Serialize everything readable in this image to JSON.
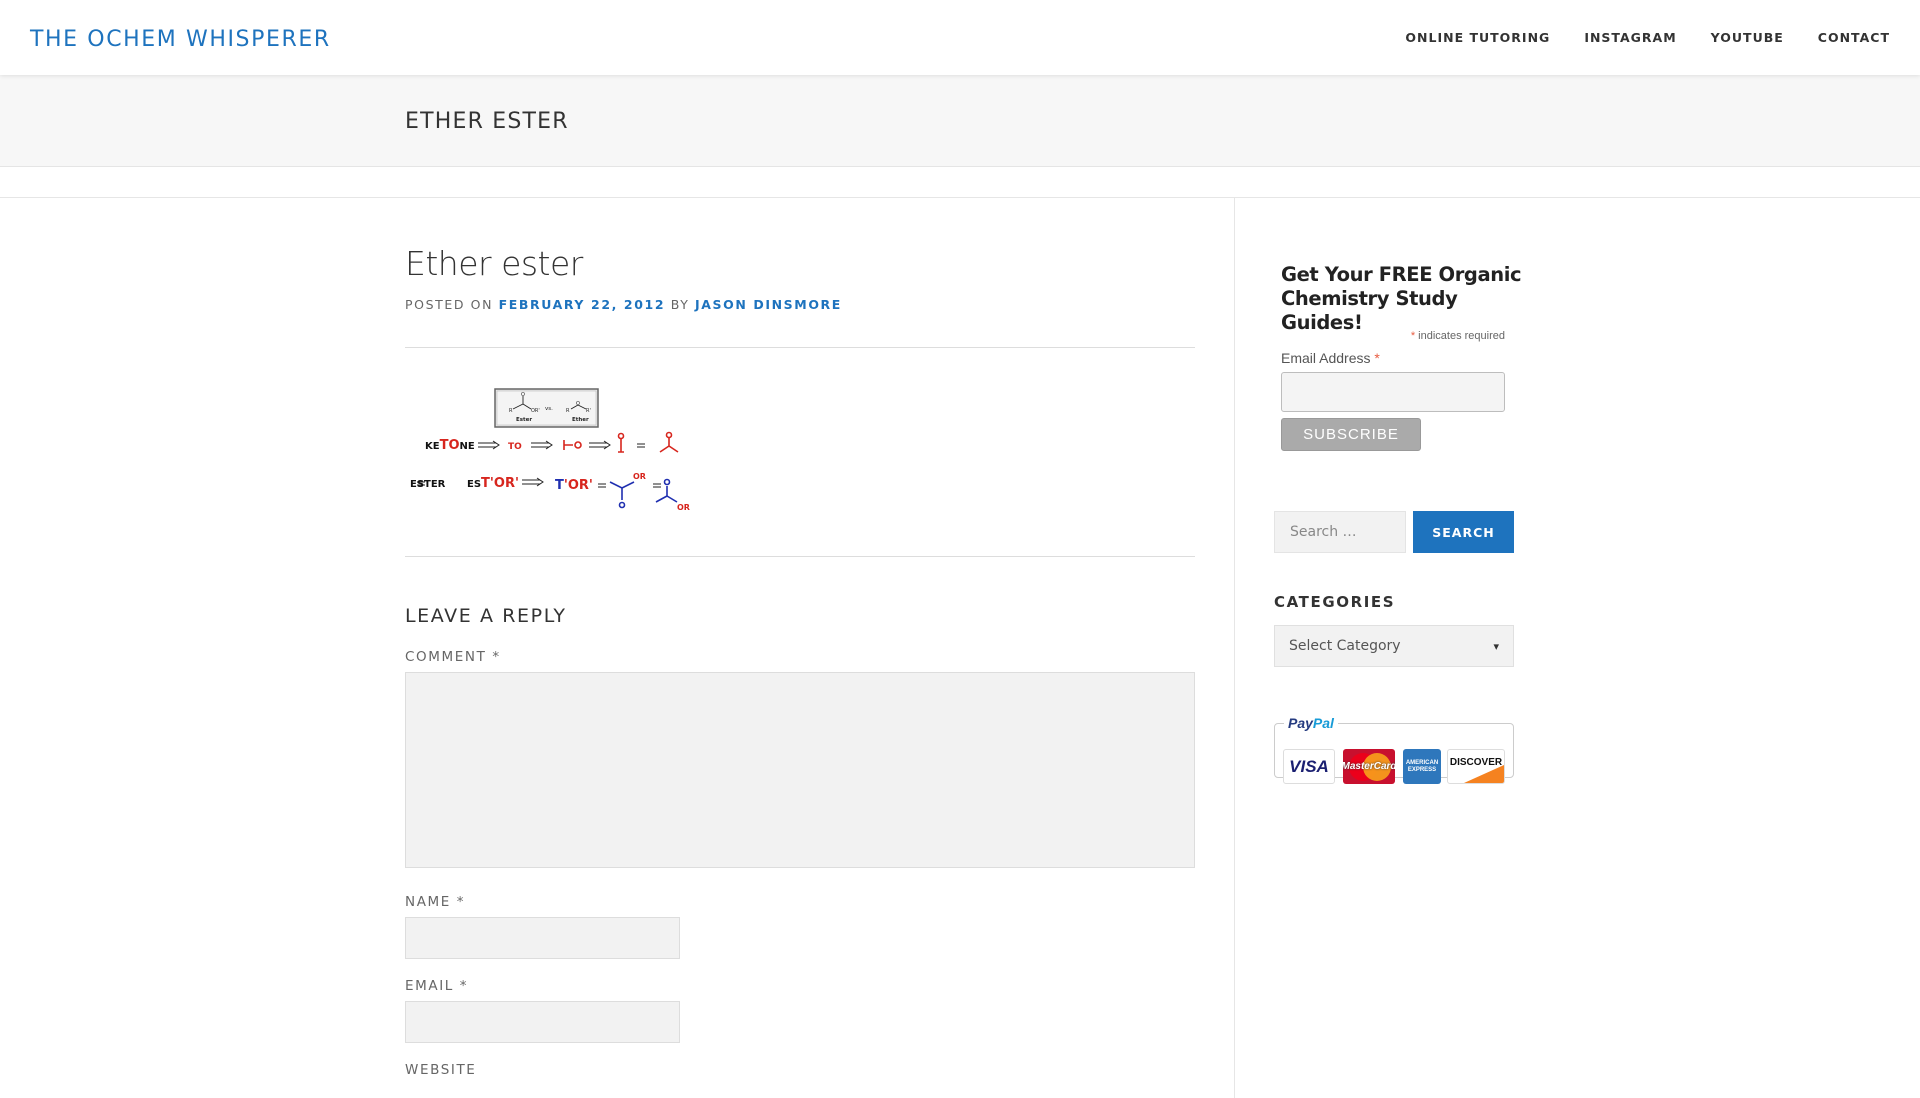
{
  "site": {
    "title": "THE OCHEM WHISPERER"
  },
  "nav": {
    "items": [
      {
        "label": "ONLINE TUTORING"
      },
      {
        "label": "INSTAGRAM"
      },
      {
        "label": "YOUTUBE"
      },
      {
        "label": "CONTACT"
      }
    ]
  },
  "page_header": {
    "title": "ETHER ESTER"
  },
  "post": {
    "title": "Ether ester",
    "meta": {
      "posted_on": "POSTED ON",
      "date": "FEBRUARY 22, 2012",
      "by": "BY",
      "author": "JASON DINSMORE"
    },
    "diagram": {
      "ester_label": "Ester",
      "vs_label": "vs.",
      "ether_label": "Ether",
      "row1_left_plain": "KE",
      "row1_left_red": "TO",
      "row1_left_end": "NE",
      "row1_mid": "TO",
      "row2_left": "ESTER",
      "row2_mid_plain": "ES",
      "row2_mid_red": "T'OR'",
      "row2_result_blue": "T",
      "row2_result_red": "'OR'",
      "or_label": "OR"
    }
  },
  "comments": {
    "heading": "LEAVE A REPLY",
    "comment_label": "COMMENT *",
    "name_label": "NAME *",
    "email_label": "EMAIL *",
    "website_label": "WEBSITE"
  },
  "sidebar": {
    "mailchimp": {
      "title": "Get Your FREE Organic Chemistry Study Guides!",
      "required_star": "*",
      "required_note": " indicates required",
      "email_label": "Email Address ",
      "email_star": "*",
      "subscribe_label": "SUBSCRIBE"
    },
    "search": {
      "placeholder": "Search …",
      "button_label": "SEARCH"
    },
    "categories": {
      "heading": "CATEGORIES",
      "selected": "Select Category"
    },
    "paypal": {
      "brand_pay": "Pay",
      "brand_pal": "Pal",
      "cards": {
        "visa": "VISA",
        "mastercard": "MasterCard",
        "amex": "AMERICAN EXPRESS",
        "discover": "DISCOVER"
      }
    }
  },
  "colors": {
    "link": "#1e73be",
    "required_star": "#e85c41",
    "diagram_red": "#d7261e",
    "diagram_blue": "#1f2fb0"
  }
}
